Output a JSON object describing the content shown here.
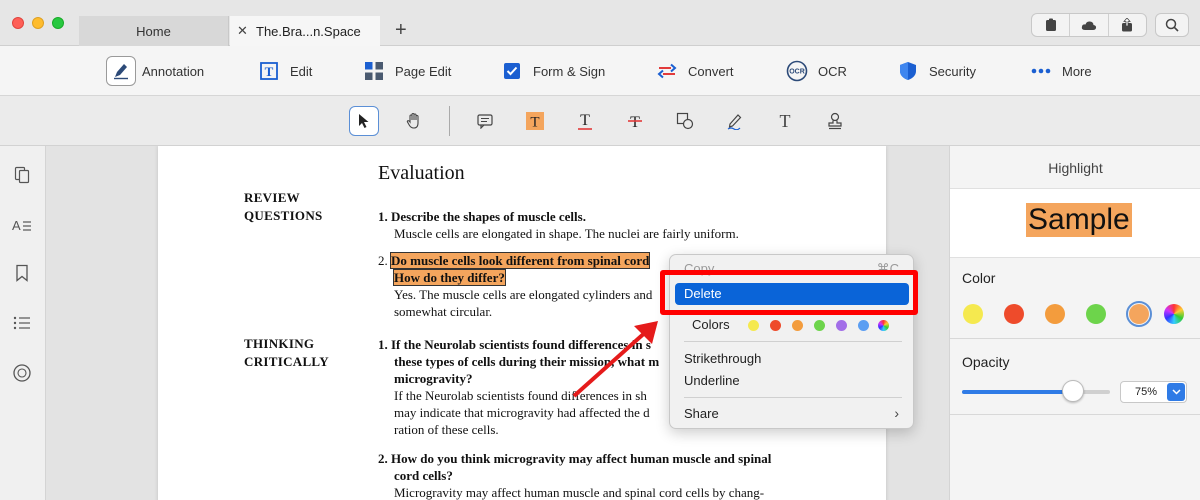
{
  "tabs": [
    {
      "label": "Home"
    },
    {
      "label": "The.Bra...n.Space"
    }
  ],
  "main_toolbar": [
    {
      "label": "Annotation",
      "icon": "annotation-pen-icon"
    },
    {
      "label": "Edit",
      "icon": "edit-text-icon"
    },
    {
      "label": "Page Edit",
      "icon": "page-grid-icon"
    },
    {
      "label": "Form & Sign",
      "icon": "checkbox-icon"
    },
    {
      "label": "Convert",
      "icon": "convert-arrows-icon"
    },
    {
      "label": "OCR",
      "icon": "ocr-icon"
    },
    {
      "label": "Security",
      "icon": "shield-icon"
    },
    {
      "label": "More",
      "icon": "more-dots-icon"
    }
  ],
  "document": {
    "title": "Evaluation",
    "section1": "REVIEW",
    "section1b": "QUESTIONS",
    "q1_title": "1. Describe the shapes of muscle cells.",
    "q1_answer": "Muscle cells are elongated in shape. The nuclei are fairly uniform.",
    "q2_num": "2.",
    "q2_line1": "Do muscle cells look different from spinal cord",
    "q2_line2": "How do they differ?",
    "q2_answer1": "Yes. The muscle cells are elongated cylinders and",
    "q2_answer2": "somewhat circular.",
    "section2": "THINKING",
    "section2b": "CRITICALLY",
    "t1_line1": "1. If the Neurolab scientists found differences in s",
    "t1_line2": "these types of cells during their mission, what m",
    "t1_line3": "microgravity?",
    "t1_ans1": "If the Neurolab scientists found differences in sh",
    "t1_ans2": "may indicate that microgravity had affected the d",
    "t1_ans3": "ration of these cells.",
    "t2_line1": "2. How do you think microgravity may affect human muscle and spinal",
    "t2_line2": "cord cells?",
    "t2_ans1": "Microgravity may affect human muscle and spinal cord cells by chang-"
  },
  "context_menu": {
    "copy": "Copy",
    "copy_shortcut": "⌘C",
    "delete": "Delete",
    "colors": "Colors",
    "color_swatches": [
      "#f5e94f",
      "#ee4b2b",
      "#f39c3d",
      "#6dd44b",
      "#a26ee8",
      "#5b9ef2"
    ],
    "strikethrough": "Strikethrough",
    "underline": "Underline",
    "share": "Share"
  },
  "right_panel": {
    "title": "Highlight",
    "sample": "Sample",
    "color_label": "Color",
    "colors": [
      "#f5e94f",
      "#ee4b2b",
      "#f39c3d",
      "#6dd44b",
      "#f4a55d"
    ],
    "selected_color": "#f4a55d",
    "opacity_label": "Opacity",
    "opacity_value": "75%",
    "opacity_fraction": 0.75
  }
}
